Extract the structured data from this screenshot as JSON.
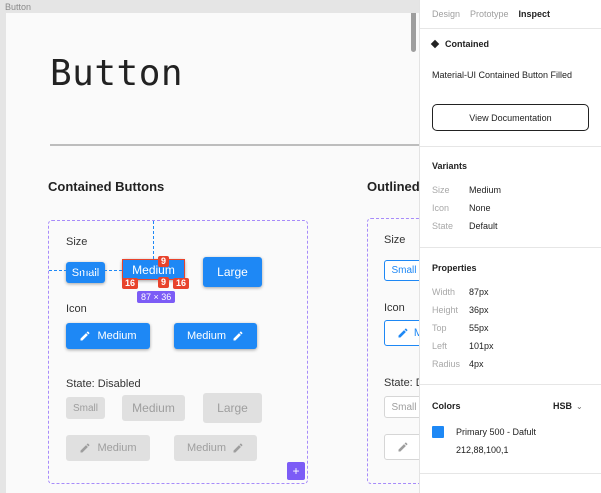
{
  "canvas": {
    "frame_label": "Button",
    "title": "Button",
    "sections": {
      "contained": "Contained Buttons",
      "outlined": "Outlined"
    },
    "contained_box": {
      "size_label": "Size",
      "icon_label": "Icon",
      "disabled_label": "State: Disabled",
      "small": "Small",
      "medium": "Medium",
      "large": "Large"
    },
    "outlined_box": {
      "size_label": "Size",
      "icon_label": "Icon",
      "disabled_label": "State: D",
      "small": "Small",
      "medium_partial": "M"
    },
    "measurements": {
      "top": "9",
      "bottom": "9",
      "left": "16",
      "right": "16",
      "dimensions": "87 × 36"
    },
    "plus": "+"
  },
  "panel": {
    "tabs": [
      "Design",
      "Prototype",
      "Inspect"
    ],
    "active_tab": "Inspect",
    "component": "Contained",
    "description": "Material-UI Contained Button Filled",
    "doc_button": "View Documentation",
    "variants": {
      "title": "Variants",
      "rows": [
        {
          "key": "Size",
          "value": "Medium"
        },
        {
          "key": "Icon",
          "value": "None"
        },
        {
          "key": "State",
          "value": "Default"
        }
      ]
    },
    "properties": {
      "title": "Properties",
      "rows": [
        {
          "key": "Width",
          "value": "87px"
        },
        {
          "key": "Height",
          "value": "36px"
        },
        {
          "key": "Top",
          "value": "55px"
        },
        {
          "key": "Left",
          "value": "101px"
        },
        {
          "key": "Radius",
          "value": "4px"
        }
      ]
    },
    "colors": {
      "title": "Colors",
      "mode": "HSB",
      "swatch_color": "#1e88f5",
      "name": "Primary 500 - Dafult",
      "value": "212,88,100,1"
    }
  },
  "theme": {
    "primary": "#1e88f5",
    "selection": "#e8432c",
    "frame_accent": "#7c5cf6"
  }
}
